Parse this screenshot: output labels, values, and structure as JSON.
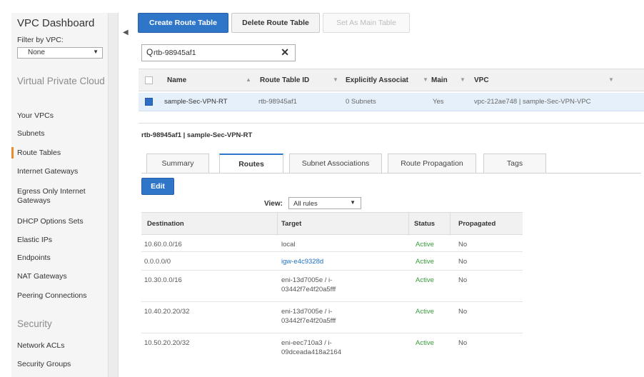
{
  "sidebar": {
    "title": "VPC Dashboard",
    "filter_label": "Filter by VPC:",
    "filter_value": "None",
    "section_vpc": "Virtual Private Cloud",
    "items": [
      "Your VPCs",
      "Subnets",
      "Route Tables",
      "Internet Gateways",
      "Egress Only Internet Gateways",
      "DHCP Options Sets",
      "Elastic IPs",
      "Endpoints",
      "NAT Gateways",
      "Peering Connections"
    ],
    "active_item": "Route Tables",
    "section_security": "Security",
    "security_items": [
      "Network ACLs",
      "Security Groups"
    ]
  },
  "toolbar": {
    "create_label": "Create Route Table",
    "delete_label": "Delete Route Table",
    "main_label": "Set As Main Table"
  },
  "search": {
    "value": "rtb-98945af1"
  },
  "list": {
    "columns": [
      "Name",
      "Route Table ID",
      "Explicitly Associat",
      "Main",
      "VPC"
    ],
    "row": {
      "name": "sample-Sec-VPN-RT",
      "id": "rtb-98945af1",
      "subnets": "0 Subnets",
      "main": "Yes",
      "vpc": "vpc-212ae748 | sample-Sec-VPN-VPC"
    }
  },
  "detail": {
    "title": "rtb-98945af1 | sample-Sec-VPN-RT",
    "tabs": [
      "Summary",
      "Routes",
      "Subnet Associations",
      "Route Propagation",
      "Tags"
    ],
    "active_tab": "Routes",
    "edit_label": "Edit",
    "view_label": "View:",
    "view_value": "All rules"
  },
  "routes": {
    "columns": [
      "Destination",
      "Target",
      "Status",
      "Propagated"
    ],
    "rows": [
      {
        "destination": "10.60.0.0/16",
        "target": "local",
        "target_line2": "",
        "status": "Active",
        "propagated": "No"
      },
      {
        "destination": "0.0.0.0/0",
        "target": "igw-e4c9328d",
        "target_line2": "",
        "status": "Active",
        "propagated": "No"
      },
      {
        "destination": "10.30.0.0/16",
        "target": "eni-13d7005e / i-",
        "target_line2": "03442f7e4f20a5fff",
        "status": "Active",
        "propagated": "No"
      },
      {
        "destination": "10.40.20.20/32",
        "target": "eni-13d7005e / i-",
        "target_line2": "03442f7e4f20a5fff",
        "status": "Active",
        "propagated": "No"
      },
      {
        "destination": "10.50.20.20/32",
        "target": "eni-eec710a3 / i-",
        "target_line2": "09dceada418a2164",
        "status": "Active",
        "propagated": "No"
      }
    ]
  },
  "colors": {
    "primary": "#2f76c9",
    "active_status": "#3a9b3a",
    "link": "#1e6fc4",
    "nav_active": "#e88c2b"
  }
}
